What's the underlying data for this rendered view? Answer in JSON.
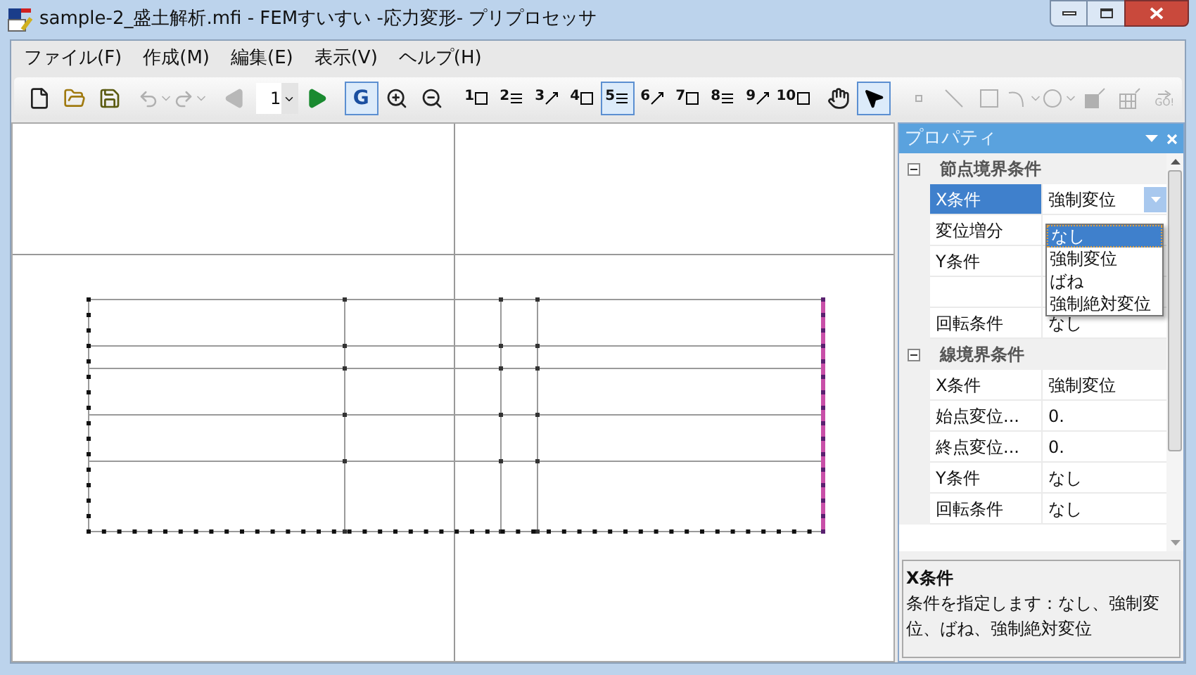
{
  "window": {
    "title": "sample-2_盛土解析.mfi - FEMすいすい -応力変形- プリプロセッサ"
  },
  "menu": [
    {
      "label": "ファイル(F)"
    },
    {
      "label": "作成(M)"
    },
    {
      "label": "編集(E)"
    },
    {
      "label": "表示(V)"
    },
    {
      "label": "ヘルプ(H)"
    }
  ],
  "toolbar": [
    {
      "kind": "new",
      "disabled": false
    },
    {
      "kind": "open",
      "disabled": false
    },
    {
      "kind": "save",
      "disabled": false
    },
    {
      "kind": "separator"
    },
    {
      "kind": "undo",
      "disabled": true
    },
    {
      "kind": "redo",
      "disabled": true
    },
    {
      "kind": "separator"
    },
    {
      "kind": "prev",
      "disabled": true
    },
    {
      "kind": "page",
      "value": "1"
    },
    {
      "kind": "next",
      "disabled": false
    },
    {
      "kind": "separator"
    },
    {
      "kind": "letter",
      "label": "G",
      "selected": true
    },
    {
      "kind": "zoom-in",
      "selected": false
    },
    {
      "kind": "zoom-out",
      "selected": false
    },
    {
      "kind": "separator"
    },
    {
      "kind": "step",
      "label": "1",
      "selected": false
    },
    {
      "kind": "step",
      "label": "2",
      "selected": false
    },
    {
      "kind": "step",
      "label": "3",
      "selected": false
    },
    {
      "kind": "step",
      "label": "4",
      "selected": false
    },
    {
      "kind": "step",
      "label": "5",
      "selected": true
    },
    {
      "kind": "step",
      "label": "6",
      "selected": false
    },
    {
      "kind": "step",
      "label": "7",
      "selected": false
    },
    {
      "kind": "step",
      "label": "8",
      "selected": false
    },
    {
      "kind": "step",
      "label": "9",
      "selected": false
    },
    {
      "kind": "step",
      "label": "10",
      "selected": false
    },
    {
      "kind": "separator"
    },
    {
      "kind": "pan",
      "selected": false
    },
    {
      "kind": "pointer",
      "selected": true
    },
    {
      "kind": "separator"
    },
    {
      "kind": "point",
      "disabled": true
    },
    {
      "kind": "line",
      "disabled": true
    },
    {
      "kind": "rect",
      "disabled": true
    },
    {
      "kind": "arc",
      "disabled": true
    },
    {
      "kind": "circle",
      "disabled": true
    },
    {
      "kind": "fill",
      "disabled": true
    },
    {
      "kind": "mesh",
      "disabled": true
    },
    {
      "kind": "go",
      "label": "GO!",
      "disabled": true
    }
  ],
  "properties": {
    "title": "プロパティ",
    "categories": [
      {
        "label": "節点境界条件",
        "expanded": true,
        "rows": [
          {
            "name": "X条件",
            "value": "強制変位",
            "selected": true
          },
          {
            "name": "変位増分",
            "selected": false
          },
          {
            "name": "Y条件",
            "selected": false
          },
          {
            "selected": false
          },
          {
            "name": "回転条件",
            "value": "なし",
            "selected": false
          }
        ]
      },
      {
        "label": "線境界条件",
        "expanded": true,
        "rows": [
          {
            "name": "X条件",
            "value": "強制変位",
            "selected": false
          },
          {
            "name": "始点変位...",
            "value": "0.",
            "selected": false
          },
          {
            "name": "終点変位...",
            "value": "0.",
            "selected": false
          },
          {
            "name": "Y条件",
            "value": "なし",
            "selected": false
          },
          {
            "name": "回転条件",
            "value": "なし",
            "selected": false
          }
        ]
      }
    ],
    "dropdown": [
      {
        "label": "なし",
        "selected": true
      },
      {
        "label": "強制変位",
        "selected": false
      },
      {
        "label": "ばね",
        "selected": false
      },
      {
        "label": "強制絶対変位",
        "selected": false
      }
    ],
    "description": {
      "title": "X条件",
      "text": "条件を指定します：なし、強制変位、ばね、強制絶対変位"
    }
  }
}
